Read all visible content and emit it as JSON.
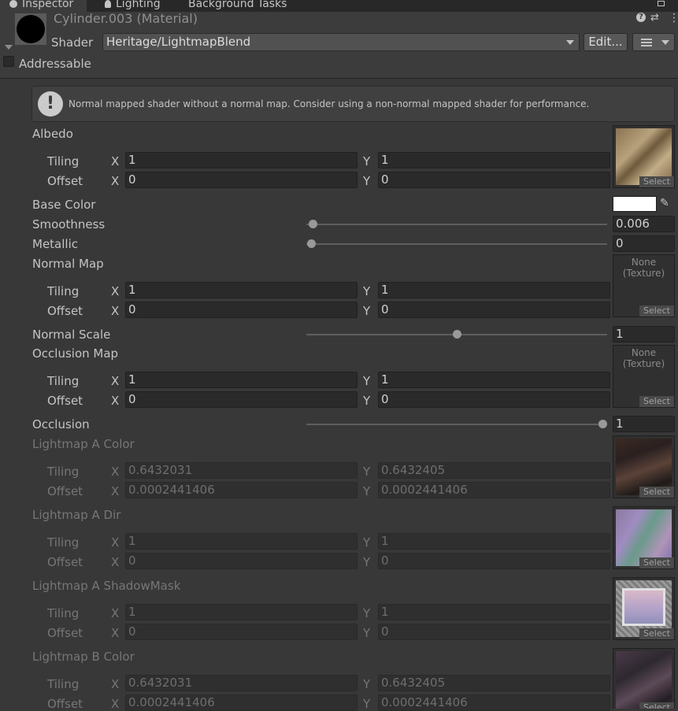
{
  "tabs": [
    "Inspector",
    "Lighting",
    "Background Tasks"
  ],
  "material": {
    "title": "Cylinder.003 (Material)",
    "shader_label": "Shader",
    "shader_value": "Heritage/LightmapBlend",
    "edit_label": "Edit...",
    "addressable_label": "Addressable"
  },
  "help_box": {
    "icon": "!",
    "message": "Normal mapped shader without a normal map. Consider using a non-normal mapped shader for performance."
  },
  "common": {
    "tiling": "Tiling",
    "offset": "Offset",
    "x": "X",
    "y": "Y",
    "select": "Select",
    "none_texture_line1": "None",
    "none_texture_line2": "(Texture)"
  },
  "properties": {
    "albedo": {
      "label": "Albedo",
      "tiling_x": "1",
      "tiling_y": "1",
      "offset_x": "0",
      "offset_y": "0"
    },
    "base_color": {
      "label": "Base Color",
      "color": "#ffffff"
    },
    "smoothness": {
      "label": "Smoothness",
      "value": "0.006",
      "fraction": 0.006
    },
    "metallic": {
      "label": "Metallic",
      "value": "0",
      "fraction": 0
    },
    "normal_map": {
      "label": "Normal Map",
      "tiling_x": "1",
      "tiling_y": "1",
      "offset_x": "0",
      "offset_y": "0"
    },
    "normal_scale": {
      "label": "Normal Scale",
      "value": "1",
      "fraction": 0.5
    },
    "occlusion_map": {
      "label": "Occlusion Map",
      "tiling_x": "1",
      "tiling_y": "1",
      "offset_x": "0",
      "offset_y": "0"
    },
    "occlusion": {
      "label": "Occlusion",
      "value": "1",
      "fraction": 1
    },
    "lightmap_a_color": {
      "label": "Lightmap A Color",
      "tiling_x": "0.6432031",
      "tiling_y": "0.6432405",
      "offset_x": "0.0002441406",
      "offset_y": "0.0002441406"
    },
    "lightmap_a_dir": {
      "label": "Lightmap A Dir",
      "tiling_x": "1",
      "tiling_y": "1",
      "offset_x": "0",
      "offset_y": "0"
    },
    "lightmap_a_shadowmask": {
      "label": "Lightmap A ShadowMask",
      "tiling_x": "1",
      "tiling_y": "1",
      "offset_x": "0",
      "offset_y": "0"
    },
    "lightmap_b_color": {
      "label": "Lightmap B Color",
      "tiling_x": "0.6432031",
      "tiling_y": "0.6432405",
      "offset_x": "0.0002441406",
      "offset_y": "0.0002441406"
    }
  },
  "icons": [
    "info-icon",
    "lightbulb-icon",
    "help-icon",
    "presets-icon",
    "kebab-menu-icon",
    "eyedropper-icon",
    "warning-icon"
  ]
}
